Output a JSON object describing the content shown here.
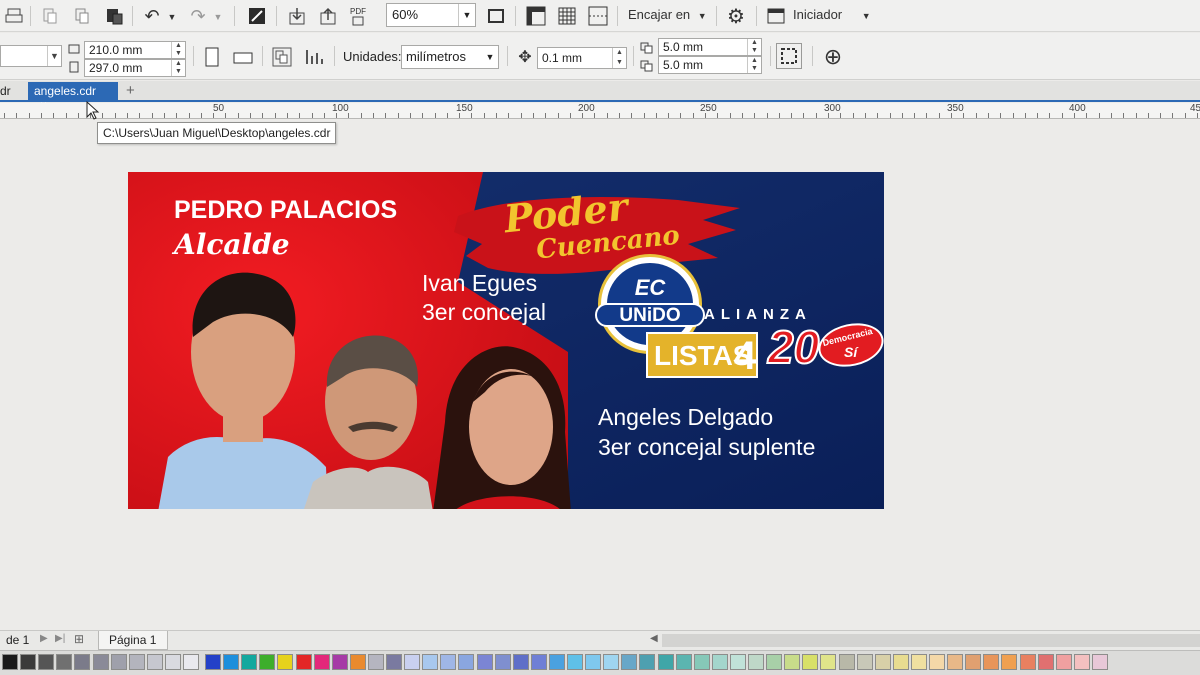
{
  "toolbar": {
    "zoom_value": "60%",
    "fit_label": "Encajar en",
    "launcher_label": "Iniciador",
    "pdf_label": "PDF"
  },
  "properties": {
    "width": "210.0 mm",
    "height": "297.0 mm",
    "units_label": "Unidades:",
    "units_value": "milímetros",
    "nudge": "0.1 mm",
    "dup_x": "5.0 mm",
    "dup_y": "5.0 mm"
  },
  "tabs": {
    "prev_label": "dr",
    "active_label": "angeles.cdr",
    "close_glyph": "×",
    "add_glyph": "+"
  },
  "ruler": {
    "labels": [
      "50",
      "100",
      "150",
      "200",
      "250",
      "300",
      "350",
      "400",
      "45"
    ]
  },
  "tooltip": {
    "path": "C:\\Users\\Juan Miguel\\Desktop\\angeles.cdr"
  },
  "design": {
    "candidate": "PEDRO PALACIOS",
    "candidate_role": "Alcalde",
    "slogan_line1": "Poder",
    "slogan_line2": "Cuencano",
    "person2_name": "Ivan Egues",
    "person2_role": "3er concejal",
    "logo_ec": "EC",
    "logo_unido": "UNiDO",
    "alianza": "ALIANZA",
    "listas": "LISTAS",
    "listas_num": "4",
    "num_20": "20",
    "democracia": "Democracia",
    "si": "Sí",
    "person3_name": "Angeles Delgado",
    "person3_role": "3er concejal suplente",
    "colors": {
      "red": "#e2141d",
      "navy": "#0d2665",
      "gold": "#f2c52e"
    }
  },
  "pagebar": {
    "page_of": "de 1",
    "page_tab": "Página 1"
  }
}
